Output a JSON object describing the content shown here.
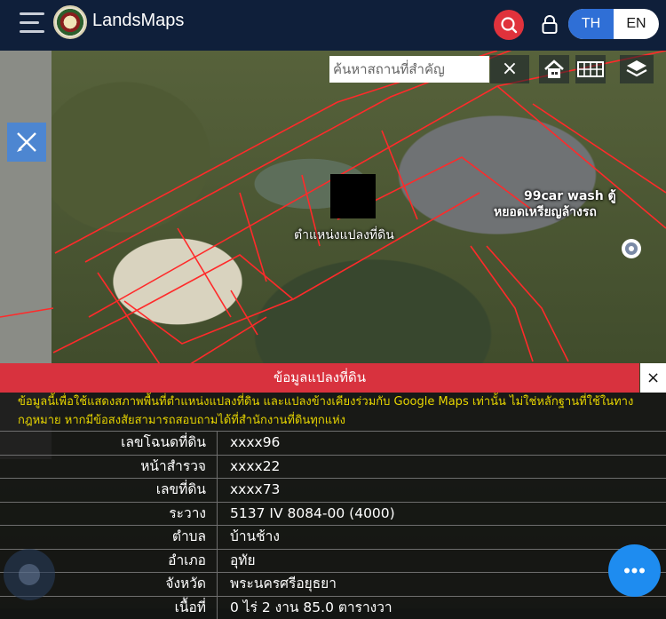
{
  "header": {
    "brand": "LandsMaps",
    "lang_th": "TH",
    "lang_en": "EN",
    "icons": [
      "menu-icon",
      "logo-seal",
      "search-icon",
      "lock-icon"
    ]
  },
  "map": {
    "search_placeholder": "ค้นหาสถานที่สำคัญ",
    "search_clear": "×",
    "parcel_label": "ตำแหน่งแปลงที่ดิน",
    "poi_line1": "99car wash ตู้",
    "poi_line2": "หยอดเหรียญล้างรถ",
    "buttons": [
      "home-icon",
      "grid-icon",
      "layers-icon",
      "draw-tools-icon"
    ]
  },
  "panel": {
    "title": "ข้อมูลแปลงที่ดิน",
    "close": "×",
    "notice": "ข้อมูลนี้เพื่อใช้แสดงสภาพพื้นที่ตำแหน่งแปลงที่ดิน และแปลงข้างเคียงร่วมกับ Google Maps เท่านั้น ไม่ใช่หลักฐานที่ใช้ในทางกฎหมาย หากมีข้อสงสัยสามารถสอบถามได้ที่สำนักงานที่ดินทุกแห่ง",
    "rows": [
      {
        "label": "เลขโฉนดที่ดิน",
        "value": "xxxx96"
      },
      {
        "label": "หน้าสำรวจ",
        "value": "xxxx22"
      },
      {
        "label": "เลขที่ดิน",
        "value": "xxxx73"
      },
      {
        "label": "ระวาง",
        "value": "5137 IV 8084-00 (4000)"
      },
      {
        "label": "ตำบล",
        "value": "บ้านช้าง"
      },
      {
        "label": "อำเภอ",
        "value": "อุทัย"
      },
      {
        "label": "จังหวัด",
        "value": "พระนครศรีอยุธยา"
      },
      {
        "label": "เนื้อที่",
        "value": "0 ไร่ 2 งาน 85.0 ตารางวา"
      }
    ]
  },
  "colors": {
    "topbar": "#0f1f3a",
    "accent_red": "#d8323e",
    "accent_blue": "#1e8cf0",
    "notice_text": "#e6d400"
  }
}
